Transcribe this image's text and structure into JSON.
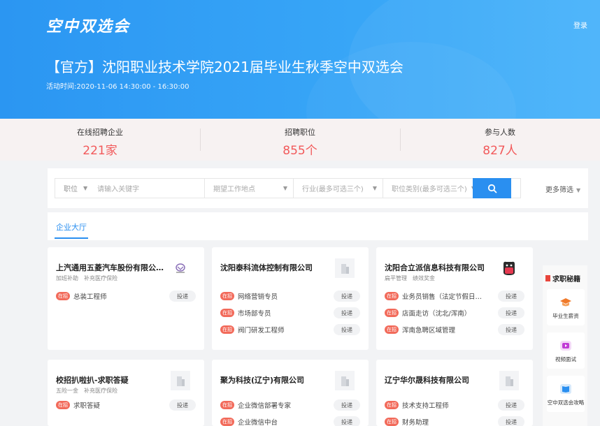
{
  "header": {
    "logo": "空中双选会",
    "login": "登录",
    "title": "【官方】沈阳职业技术学院2021届毕业生秋季空中双选会",
    "time": "活动时间:2020-11-06 14:30:00 - 16:30:00"
  },
  "stats": [
    {
      "label": "在线招聘企业",
      "value": "221家"
    },
    {
      "label": "招聘职位",
      "value": "855个"
    },
    {
      "label": "参与人数",
      "value": "827人"
    }
  ],
  "search": {
    "type_select": "职位",
    "keyword_placeholder": "请输入关键字",
    "location_placeholder": "期望工作地点",
    "industry_placeholder": "行业(最多可选三个)",
    "category_placeholder": "职位类别(最多可选三个)",
    "more_filter": "更多筛选"
  },
  "tabs": [
    {
      "label": "企业大厅",
      "active": true
    }
  ],
  "hot_label": "在招",
  "apply_label": "投递",
  "companies": [
    {
      "name": "上汽通用五菱汽车股份有限公司...",
      "tags": [
        "加班补助",
        "补充医疗保险"
      ],
      "logo": "wuling-logo",
      "jobs": [
        "总装工程师"
      ]
    },
    {
      "name": "沈阳泰科流体控制有限公司",
      "tags": [],
      "logo": "building-icon",
      "jobs": [
        "网络营销专员",
        "市场部专员",
        "阀门研发工程师"
      ]
    },
    {
      "name": "沈阳合立派信息科技有限公司",
      "tags": [
        "扁平管理",
        "绩效奖金"
      ],
      "logo": "company-mascot-logo",
      "jobs": [
        "业务员销售（法定节假日休息...",
        "店面走访（沈北/浑南）",
        "浑南急聘区域管理"
      ]
    },
    {
      "name": "校招扒啦扒-求职答疑",
      "tags": [
        "五险一金",
        "补充医疗保险"
      ],
      "logo": "building-icon",
      "jobs": [
        "求职答疑"
      ]
    },
    {
      "name": "聚为科技(辽宁)有限公司",
      "tags": [],
      "logo": "building-icon",
      "jobs": [
        "企业微信部署专家",
        "企业微信中台"
      ]
    },
    {
      "name": "辽宁华尔晟科技有限公司",
      "tags": [],
      "logo": "building-icon",
      "jobs": [
        "技术支持工程师",
        "财务助理"
      ]
    }
  ],
  "sidebar": {
    "title": "求职秘籍",
    "items": [
      {
        "label": "毕业生薪资",
        "icon": "graduation-cap-icon",
        "color": "#f07a2a"
      },
      {
        "label": "视频面试",
        "icon": "video-icon",
        "color": "#c13bd6"
      },
      {
        "label": "空中双选会攻略",
        "icon": "book-icon",
        "color": "#2a8ff0"
      }
    ]
  },
  "colors": {
    "primary": "#2a8ff0",
    "accent": "#f2595a",
    "hot": "#f26a5a"
  }
}
